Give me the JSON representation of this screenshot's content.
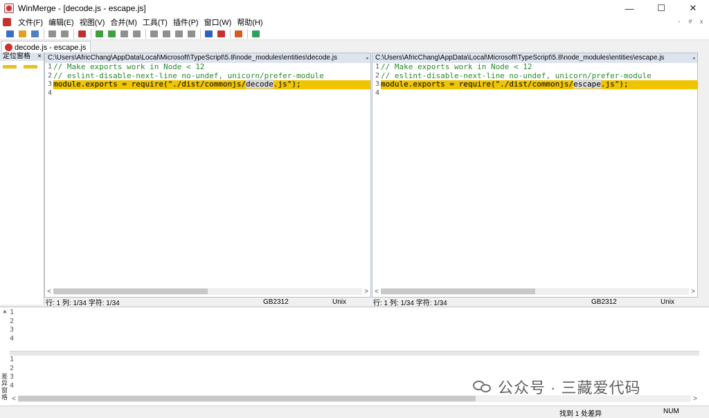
{
  "window": {
    "title": "WinMerge - [decode.js - escape.js]",
    "controls": [
      "—",
      "☐",
      "✕"
    ]
  },
  "menu": {
    "items": [
      "文件(F)",
      "编辑(E)",
      "视图(V)",
      "合并(M)",
      "工具(T)",
      "插件(P)",
      "窗口(W)",
      "帮助(H)"
    ],
    "mdi_controls": [
      "-",
      "#",
      "x"
    ]
  },
  "toolbar": {
    "icons": [
      "new-icon",
      "open-icon",
      "save-icon",
      "undo-icon",
      "redo-icon",
      "diff-icon",
      "copy-right-icon",
      "copy-left-icon",
      "all-right-icon",
      "all-left-icon",
      "next-diff-icon",
      "prev-diff-icon",
      "first-diff-icon",
      "last-diff-icon",
      "compare-icon",
      "merge-icon",
      "options-icon",
      "refresh-icon"
    ],
    "colors": [
      "#3a6fc8",
      "#e0a020",
      "#5080c0",
      "#909090",
      "#909090",
      "#c03030",
      "#40a040",
      "#40a040",
      "#909090",
      "#909090",
      "#909090",
      "#909090",
      "#909090",
      "#909090",
      "#3060c0",
      "#c83030",
      "#d06020",
      "#30a060"
    ]
  },
  "tab": {
    "label": "decode.js - escape.js"
  },
  "location_pane": {
    "title": "定位窗格",
    "close": "×"
  },
  "left_pane": {
    "path": "C:\\Users\\AfricChang\\AppData\\Local\\Microsoft\\TypeScript\\5.8\\node_modules\\entities\\decode.js",
    "close": "▪",
    "lines": [
      {
        "num": "1",
        "pre": "// Make exports work in Node < 12",
        "hl": "",
        "post": "",
        "type": "comment"
      },
      {
        "num": "2",
        "pre": "// eslint-disable-next-line no-undef, unicorn/prefer-module",
        "hl": "",
        "post": "",
        "type": "comment"
      },
      {
        "num": "3",
        "pre": "module.exports = require(\"./dist/commonjs/",
        "hl": "decode",
        "post": ".js\");",
        "type": "diff"
      },
      {
        "num": "4",
        "pre": "",
        "hl": "",
        "post": "",
        "type": "normal"
      }
    ],
    "status": {
      "position": "行: 1  列: 1/34  字符: 1/34",
      "encoding": "GB2312",
      "eol": "Unix"
    }
  },
  "right_pane": {
    "path": "C:\\Users\\AfricChang\\AppData\\Local\\Microsoft\\TypeScript\\5.8\\node_modules\\entities\\escape.js",
    "close": "▪",
    "lines": [
      {
        "num": "1",
        "pre": "// Make exports work in Node < 12",
        "hl": "",
        "post": "",
        "type": "comment"
      },
      {
        "num": "2",
        "pre": "// eslint-disable-next-line no-undef, unicorn/prefer-module",
        "hl": "",
        "post": "",
        "type": "comment"
      },
      {
        "num": "3",
        "pre": "module.exports = require(\"./dist/commonjs/",
        "hl": "escape",
        "post": ".js\");",
        "type": "diff"
      },
      {
        "num": "4",
        "pre": "",
        "hl": "",
        "post": "",
        "type": "normal"
      }
    ],
    "status": {
      "position": "行: 1  列: 1/34  字符: 1/34",
      "encoding": "GB2312",
      "eol": "Unix"
    }
  },
  "diff_pane": {
    "title": "差异窗格",
    "close": "×",
    "top_lines": [
      "1",
      "2",
      "3",
      "4"
    ],
    "bottom_lines": [
      "1",
      "2",
      "3",
      "4"
    ]
  },
  "statusbar": {
    "diff_count": "找到 1 处差异",
    "num": "NUM"
  },
  "watermark": {
    "text": "公众号 · 三藏爱代码"
  }
}
